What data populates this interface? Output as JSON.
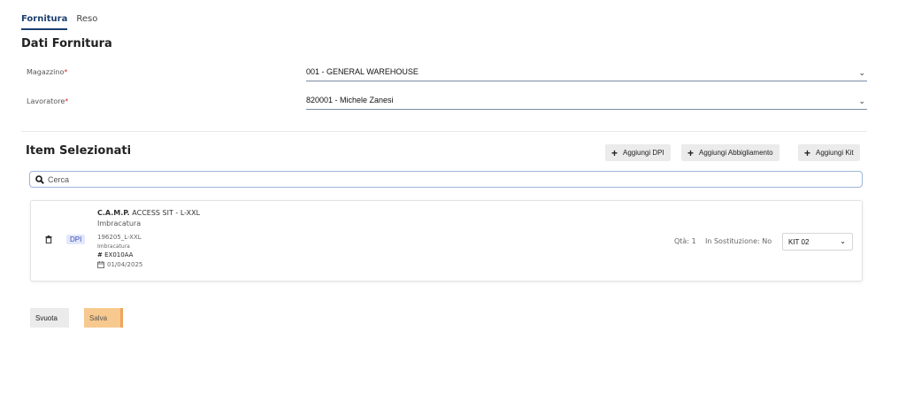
{
  "tabs": [
    {
      "label": "Fornitura",
      "active": true
    },
    {
      "label": "Reso",
      "active": false
    }
  ],
  "dati_fornitura": {
    "title": "Dati Fornitura",
    "fields": [
      {
        "label": "Magazzino",
        "required_mark": "*",
        "value": "001 - GENERAL WAREHOUSE"
      },
      {
        "label": "Lavoratore",
        "required_mark": "*",
        "value": "820001 - Michele Zanesi"
      }
    ]
  },
  "items": {
    "title": "Item Selezionati",
    "buttons": [
      {
        "label": "Aggiungi DPI"
      },
      {
        "label": "Aggiungi Abbigliamento"
      },
      {
        "label": "Aggiungi Kit"
      }
    ],
    "search_placeholder": "Cerca",
    "list": [
      {
        "brand": "C.A.M.P.",
        "name": "ACCESS SIT - L-XXL",
        "category": "Imbracatura",
        "badge": "DPI",
        "code": "196205_L-XXL",
        "subcategory": "Imbracatura",
        "serial": "EX010AA",
        "date": "01/04/2025",
        "qty": "Qtà: 1",
        "substitution": "In Sostituzione: No",
        "kit": "KIT 02"
      }
    ]
  },
  "actions": {
    "clear_label": "Svuota",
    "save_label": "Salva"
  },
  "colors": {
    "accent": "#1c3f6e",
    "badge_bg": "#e3e8fb",
    "badge_text": "#3a50b8",
    "save_bg": "#f7c98e",
    "required": "#d0352b"
  }
}
